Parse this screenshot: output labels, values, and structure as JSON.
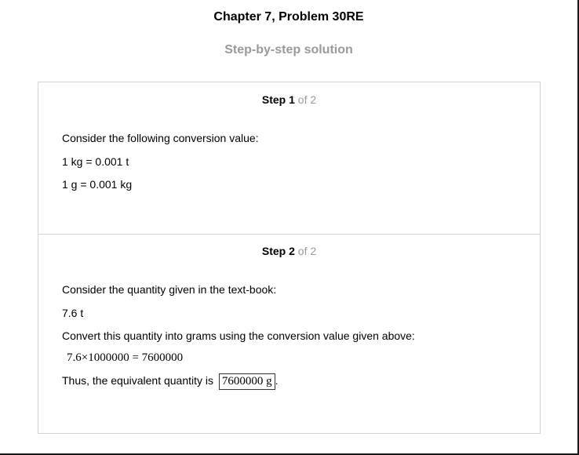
{
  "header": {
    "title": "Chapter 7, Problem 30RE",
    "subtitle": "Step-by-step solution"
  },
  "steps": [
    {
      "label": "Step",
      "number": "1",
      "of_text": "of 2",
      "lines": [
        "Consider the following conversion value:",
        "1 kg = 0.001 t",
        "1 g = 0.001 kg"
      ]
    },
    {
      "label": "Step",
      "number": "2",
      "of_text": "of 2",
      "lines": [
        "Consider the quantity given in the text-book:",
        "7.6 t",
        "Convert this quantity into grams using the conversion value given above:"
      ],
      "equation": "7.6×1000000 = 7600000",
      "conclusion_text": "Thus, the equivalent quantity is",
      "answer": "7600000 g",
      "conclusion_end": "."
    }
  ],
  "colors": {
    "muted_text": "#9a9a9a",
    "box_border": "#d4d4d4"
  }
}
